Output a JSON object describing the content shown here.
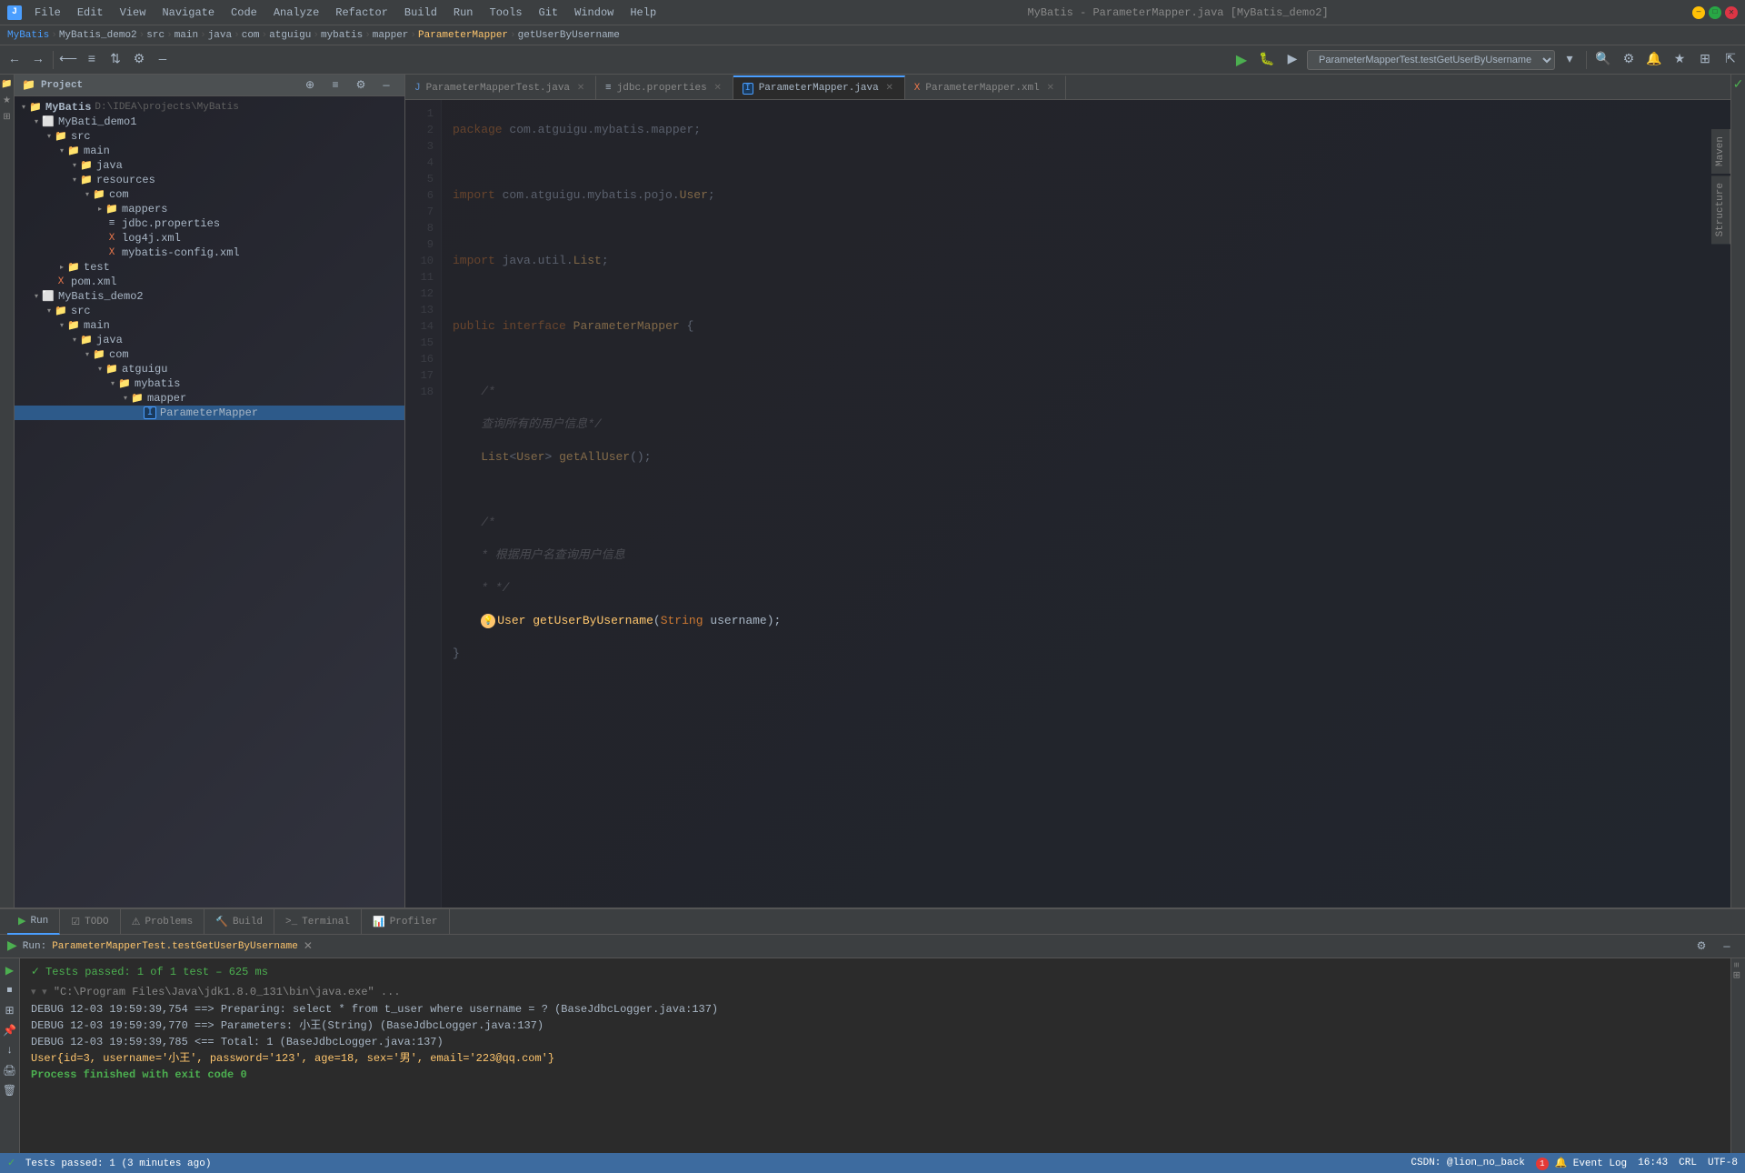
{
  "titleBar": {
    "appIcon": "J",
    "title": "MyBatis - ParameterMapper.java [MyBatis_demo2]",
    "menus": [
      "File",
      "Edit",
      "View",
      "Navigate",
      "Code",
      "Analyze",
      "Refactor",
      "Build",
      "Run",
      "Tools",
      "Git",
      "Window",
      "Help"
    ],
    "windowControls": {
      "minimize": "—",
      "maximize": "□",
      "close": "✕"
    }
  },
  "breadcrumb": {
    "items": [
      "MyBatis",
      "MyBatis_demo2",
      "src",
      "main",
      "java",
      "com",
      "atguigu",
      "mybatis",
      "mapper",
      "ParameterMapper",
      "getUserByUsername"
    ]
  },
  "runConfig": {
    "label": "ParameterMapperTest.testGetUserByUsername",
    "runBtn": "▶",
    "debugBtn": "🐛"
  },
  "projectPanel": {
    "title": "Project",
    "tree": [
      {
        "id": "mybatis",
        "label": "MyBatis",
        "path": "D:\\IDEA\\projects\\MyBatis",
        "indent": 0,
        "type": "project",
        "expanded": true
      },
      {
        "id": "mybati_demo1",
        "label": "MyBati_demo1",
        "indent": 1,
        "type": "module",
        "expanded": true
      },
      {
        "id": "src1",
        "label": "src",
        "indent": 2,
        "type": "folder",
        "expanded": true
      },
      {
        "id": "main1",
        "label": "main",
        "indent": 3,
        "type": "folder",
        "expanded": true
      },
      {
        "id": "java1",
        "label": "java",
        "indent": 4,
        "type": "folder",
        "expanded": true
      },
      {
        "id": "resources1",
        "label": "resources",
        "indent": 4,
        "type": "folder",
        "expanded": true
      },
      {
        "id": "com1",
        "label": "com",
        "indent": 5,
        "type": "folder",
        "expanded": true
      },
      {
        "id": "mappers",
        "label": "mappers",
        "indent": 6,
        "type": "folder",
        "expanded": false
      },
      {
        "id": "jdbc_prop",
        "label": "jdbc.properties",
        "indent": 6,
        "type": "properties"
      },
      {
        "id": "log4j_xml",
        "label": "log4j.xml",
        "indent": 6,
        "type": "xml"
      },
      {
        "id": "mybatis_config",
        "label": "mybatis-config.xml",
        "indent": 6,
        "type": "xml"
      },
      {
        "id": "test1",
        "label": "test",
        "indent": 3,
        "type": "folder",
        "expanded": false
      },
      {
        "id": "pom1",
        "label": "pom.xml",
        "indent": 2,
        "type": "xml"
      },
      {
        "id": "mybatis_demo2",
        "label": "MyBatis_demo2",
        "indent": 1,
        "type": "module",
        "expanded": true
      },
      {
        "id": "src2",
        "label": "src",
        "indent": 2,
        "type": "folder",
        "expanded": true
      },
      {
        "id": "main2",
        "label": "main",
        "indent": 3,
        "type": "folder",
        "expanded": true
      },
      {
        "id": "java2",
        "label": "java",
        "indent": 4,
        "type": "folder",
        "expanded": true
      },
      {
        "id": "com2",
        "label": "com",
        "indent": 5,
        "type": "folder",
        "expanded": true
      },
      {
        "id": "atguigu",
        "label": "atguigu",
        "indent": 6,
        "type": "folder",
        "expanded": true
      },
      {
        "id": "mybatis2",
        "label": "mybatis",
        "indent": 7,
        "type": "folder",
        "expanded": true
      },
      {
        "id": "mapper_pkg",
        "label": "mapper",
        "indent": 8,
        "type": "folder",
        "expanded": true
      },
      {
        "id": "parametermapper",
        "label": "ParameterMapper",
        "indent": 9,
        "type": "interface",
        "selected": true
      }
    ]
  },
  "editorTabs": [
    {
      "id": "tab1",
      "label": "ParameterMapperTest.java",
      "icon": "J",
      "iconColor": "#5c8fce",
      "active": false,
      "modified": false
    },
    {
      "id": "tab2",
      "label": "jdbc.properties",
      "icon": "≡",
      "iconColor": "#a9b7c6",
      "active": false,
      "modified": false
    },
    {
      "id": "tab3",
      "label": "ParameterMapper.java",
      "icon": "I",
      "iconColor": "#4a9eff",
      "active": true,
      "modified": false
    },
    {
      "id": "tab4",
      "label": "ParameterMapper.xml",
      "icon": "X",
      "iconColor": "#e8764b",
      "active": false,
      "modified": false
    }
  ],
  "codeLines": [
    {
      "num": 1,
      "code": "package com.atguigu.mybatis.mapper;",
      "tokens": [
        {
          "t": "kw",
          "v": "package"
        },
        {
          "t": "txt",
          "v": " com.atguigu.mybatis.mapper;"
        }
      ]
    },
    {
      "num": 2,
      "code": ""
    },
    {
      "num": 3,
      "code": "import com.atguigu.mybatis.pojo.User;",
      "tokens": [
        {
          "t": "kw",
          "v": "import"
        },
        {
          "t": "txt",
          "v": " com.atguigu.mybatis.pojo."
        },
        {
          "t": "cls",
          "v": "User"
        },
        {
          "t": "txt",
          "v": ";"
        }
      ]
    },
    {
      "num": 4,
      "code": ""
    },
    {
      "num": 5,
      "code": "import java.util.List;",
      "tokens": [
        {
          "t": "kw",
          "v": "import"
        },
        {
          "t": "txt",
          "v": " java.util."
        },
        {
          "t": "cls",
          "v": "List"
        },
        {
          "t": "txt",
          "v": ";"
        }
      ]
    },
    {
      "num": 6,
      "code": ""
    },
    {
      "num": 7,
      "code": "public interface ParameterMapper {",
      "tokens": [
        {
          "t": "kw",
          "v": "public"
        },
        {
          "t": "txt",
          "v": " "
        },
        {
          "t": "kw",
          "v": "interface"
        },
        {
          "t": "txt",
          "v": " "
        },
        {
          "t": "cls",
          "v": "ParameterMapper"
        },
        {
          "t": "txt",
          "v": " {"
        }
      ]
    },
    {
      "num": 8,
      "code": ""
    },
    {
      "num": 9,
      "code": "    /*",
      "tokens": [
        {
          "t": "comment",
          "v": "    /*"
        }
      ]
    },
    {
      "num": 10,
      "code": "    查询所有的用户信息*/",
      "tokens": [
        {
          "t": "comment",
          "v": "    查询所有的用户信息*/"
        }
      ]
    },
    {
      "num": 11,
      "code": "    List<User> getAllUser();",
      "tokens": [
        {
          "t": "cls",
          "v": "    List"
        },
        {
          "t": "txt",
          "v": "<"
        },
        {
          "t": "cls",
          "v": "User"
        },
        {
          "t": "txt",
          "v": "> "
        },
        {
          "t": "method",
          "v": "getAllUser"
        },
        {
          "t": "txt",
          "v": "();"
        }
      ]
    },
    {
      "num": 12,
      "code": ""
    },
    {
      "num": 13,
      "code": "    /*",
      "tokens": [
        {
          "t": "comment",
          "v": "    /*"
        }
      ]
    },
    {
      "num": 14,
      "code": "    * 根据用户名查询用户信息",
      "tokens": [
        {
          "t": "comment",
          "v": "    * 根据用户名查询用户信息"
        }
      ]
    },
    {
      "num": 15,
      "code": "    * */",
      "tokens": [
        {
          "t": "comment",
          "v": "    * */"
        }
      ]
    },
    {
      "num": 16,
      "code": "    User getUserByUsername(String username);",
      "tokens": [
        {
          "t": "cls",
          "v": "    User"
        },
        {
          "t": "txt",
          "v": " "
        },
        {
          "t": "method",
          "v": "getUserByUsername"
        },
        {
          "t": "txt",
          "v": "("
        },
        {
          "t": "kw",
          "v": "String"
        },
        {
          "t": "txt",
          "v": " username);"
        }
      ],
      "hasBulb": true
    },
    {
      "num": 17,
      "code": "}",
      "tokens": [
        {
          "t": "txt",
          "v": "}"
        }
      ]
    },
    {
      "num": 18,
      "code": ""
    }
  ],
  "bottomPanel": {
    "tabs": [
      {
        "id": "run",
        "label": "Run",
        "icon": "▶",
        "active": true
      },
      {
        "id": "todo",
        "label": "TODO",
        "icon": "☑",
        "active": false
      },
      {
        "id": "problems",
        "label": "Problems",
        "icon": "⚠",
        "active": false
      },
      {
        "id": "build",
        "label": "Build",
        "icon": "🔨",
        "active": false
      },
      {
        "id": "terminal",
        "label": "Terminal",
        "icon": ">_",
        "active": false
      },
      {
        "id": "profiler",
        "label": "Profiler",
        "icon": "📊",
        "active": false
      }
    ],
    "runHeader": {
      "label": "Run:",
      "testLabel": "ParameterMapperTest.testGetUserByUsername",
      "closeBtn": "✕"
    },
    "testResult": "Tests passed: 1 of 1 test – 625 ms",
    "outputLines": [
      {
        "type": "gray",
        "text": "\"C:\\Program Files\\Java\\jdk1.8.0_131\\bin\\java.exe\" ..."
      },
      {
        "type": "debug",
        "text": "DEBUG 12-03 19:59:39,754 ==>  Preparing: select * from t_user where username = ?  (BaseJdbcLogger.java:137)"
      },
      {
        "type": "debug",
        "text": "DEBUG 12-03 19:59:39,770 ==> Parameters: 小王(String)  (BaseJdbcLogger.java:137)"
      },
      {
        "type": "debug",
        "text": "DEBUG 12-03 19:59:39,785 <==      Total: 1  (BaseJdbcLogger.java:137)"
      },
      {
        "type": "user-obj",
        "text": "User{id=3, username='小王', password='123', age=18, sex='男', email='223@qq.com'}"
      },
      {
        "type": "empty",
        "text": ""
      },
      {
        "type": "success",
        "text": "Process finished with exit code 0"
      }
    ]
  },
  "statusBar": {
    "left": "Tests passed: 1 (3 minutes ago)",
    "eventLog": "🔔 Event Log",
    "position": "16:43",
    "encoding": "CRL",
    "lineEnding": "UTF-8",
    "user": "CSDN: @lion_no_back",
    "notifications": "1"
  },
  "rightVerticalTabs": [
    "Maven",
    "Structure",
    "Favorites"
  ],
  "colors": {
    "accent": "#4a9eff",
    "activeTabBorder": "#4a9eff",
    "keyword": "#cc7832",
    "className": "#ffc66d",
    "comment": "#808080",
    "string": "#6a8759",
    "statusBg": "#3d6b9f"
  }
}
